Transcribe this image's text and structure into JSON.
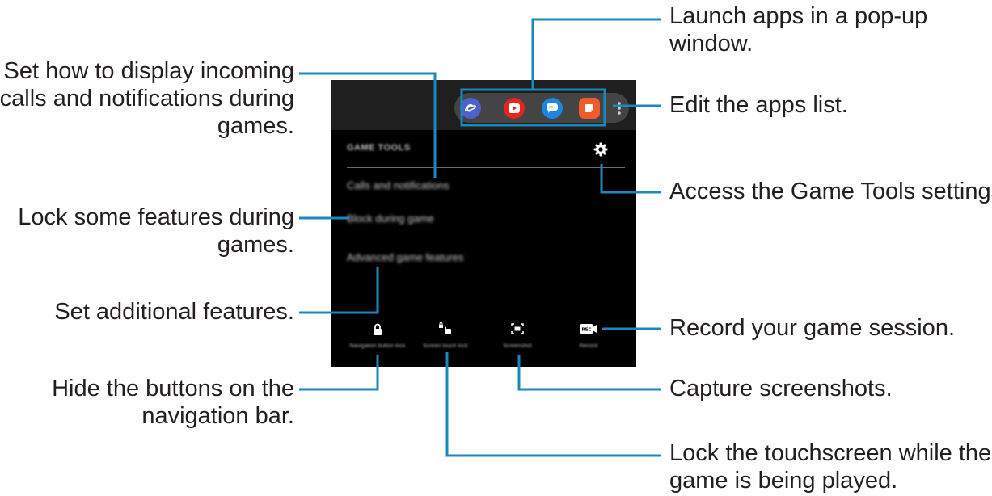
{
  "game_tools_panel": {
    "title": "GAME TOOLS",
    "menu": [
      {
        "label": "Calls and notifications"
      },
      {
        "label": "Block during game"
      },
      {
        "label": "Advanced game features"
      }
    ],
    "apps": [
      {
        "icon": "internet-app-icon",
        "color": "#4f62c9"
      },
      {
        "icon": "youtube-app-icon",
        "color": "#e6231d"
      },
      {
        "icon": "messages-app-icon",
        "color": "#1d86e0"
      },
      {
        "icon": "notes-app-icon",
        "color": "#ef5b2a"
      }
    ],
    "bottom_buttons": [
      {
        "icon": "lock-icon",
        "label": "Navigation button lock"
      },
      {
        "icon": "touch-lock-icon",
        "label": "Screen touch lock"
      },
      {
        "icon": "screenshot-icon",
        "label": "Screenshot"
      },
      {
        "icon": "record-icon",
        "label": "Record"
      }
    ]
  },
  "callouts": {
    "popup": "Launch apps in a pop-up\nwindow.",
    "edit_apps": "Edit the apps list.",
    "settings": "Access the Game Tools settings.",
    "record": "Record your game session.",
    "screenshot": "Capture screenshots.",
    "touch_lock": "Lock the touchscreen while the\ngame is being played.",
    "calls": "Set how to display incoming\ncalls and notifications during\ngames.",
    "block": "Lock some features during\ngames.",
    "advanced": "Set additional features.",
    "nav_lock": "Hide the buttons on the\nnavigation bar."
  },
  "colors": {
    "leader_line": "#1b87bd",
    "panel_bg": "#000000",
    "top_bar": "#1f1f1f"
  }
}
